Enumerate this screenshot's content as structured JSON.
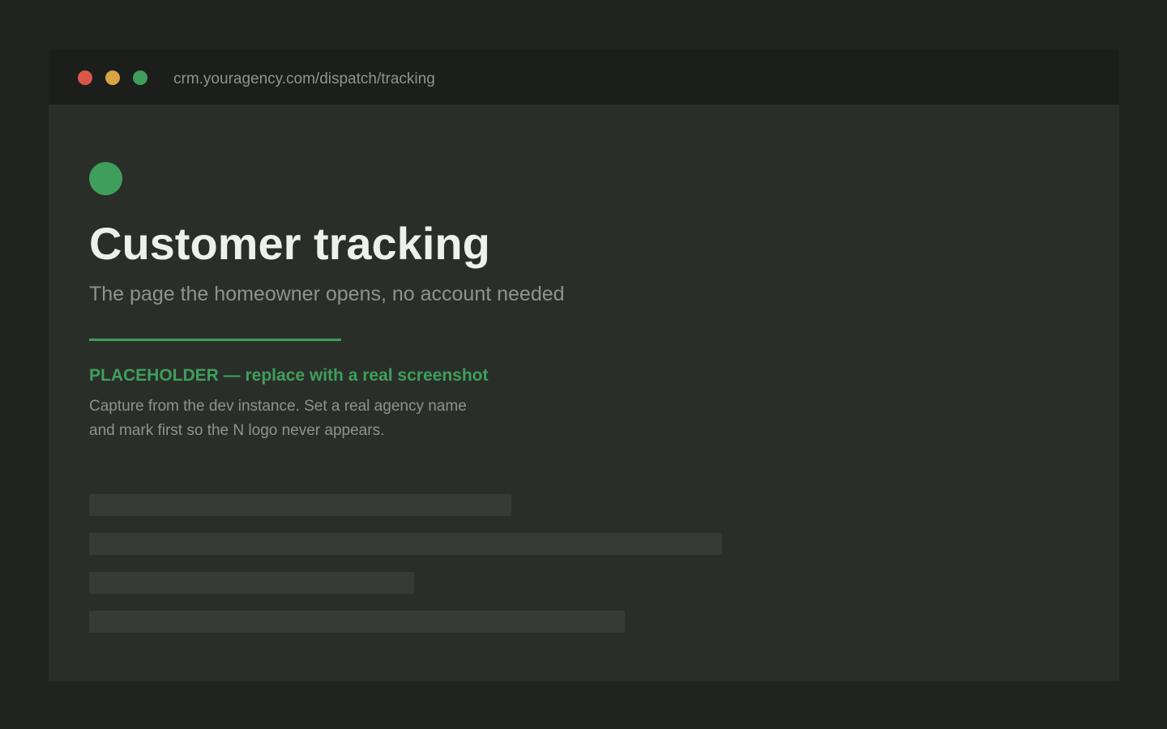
{
  "browser": {
    "url": "crm.youragency.com/dispatch/tracking",
    "controls": [
      "close",
      "minimize",
      "maximize"
    ]
  },
  "page": {
    "title": "Customer tracking",
    "subtitle": "The page the homeowner opens, no account needed",
    "placeholder": {
      "heading": "PLACEHOLDER — replace with a real screenshot",
      "body_line_1": "Capture from the dev instance. Set a real agency name",
      "body_line_2": "and mark first so the N logo never appears."
    }
  },
  "colors": {
    "background": "#212321",
    "window": "#2a2e29",
    "titlebar": "#1c1e1b",
    "accent": "#3f9e5c",
    "close": "#d9574a",
    "minimize": "#d9a444",
    "maximize": "#3f9e5c",
    "skeleton": "#363b35"
  }
}
